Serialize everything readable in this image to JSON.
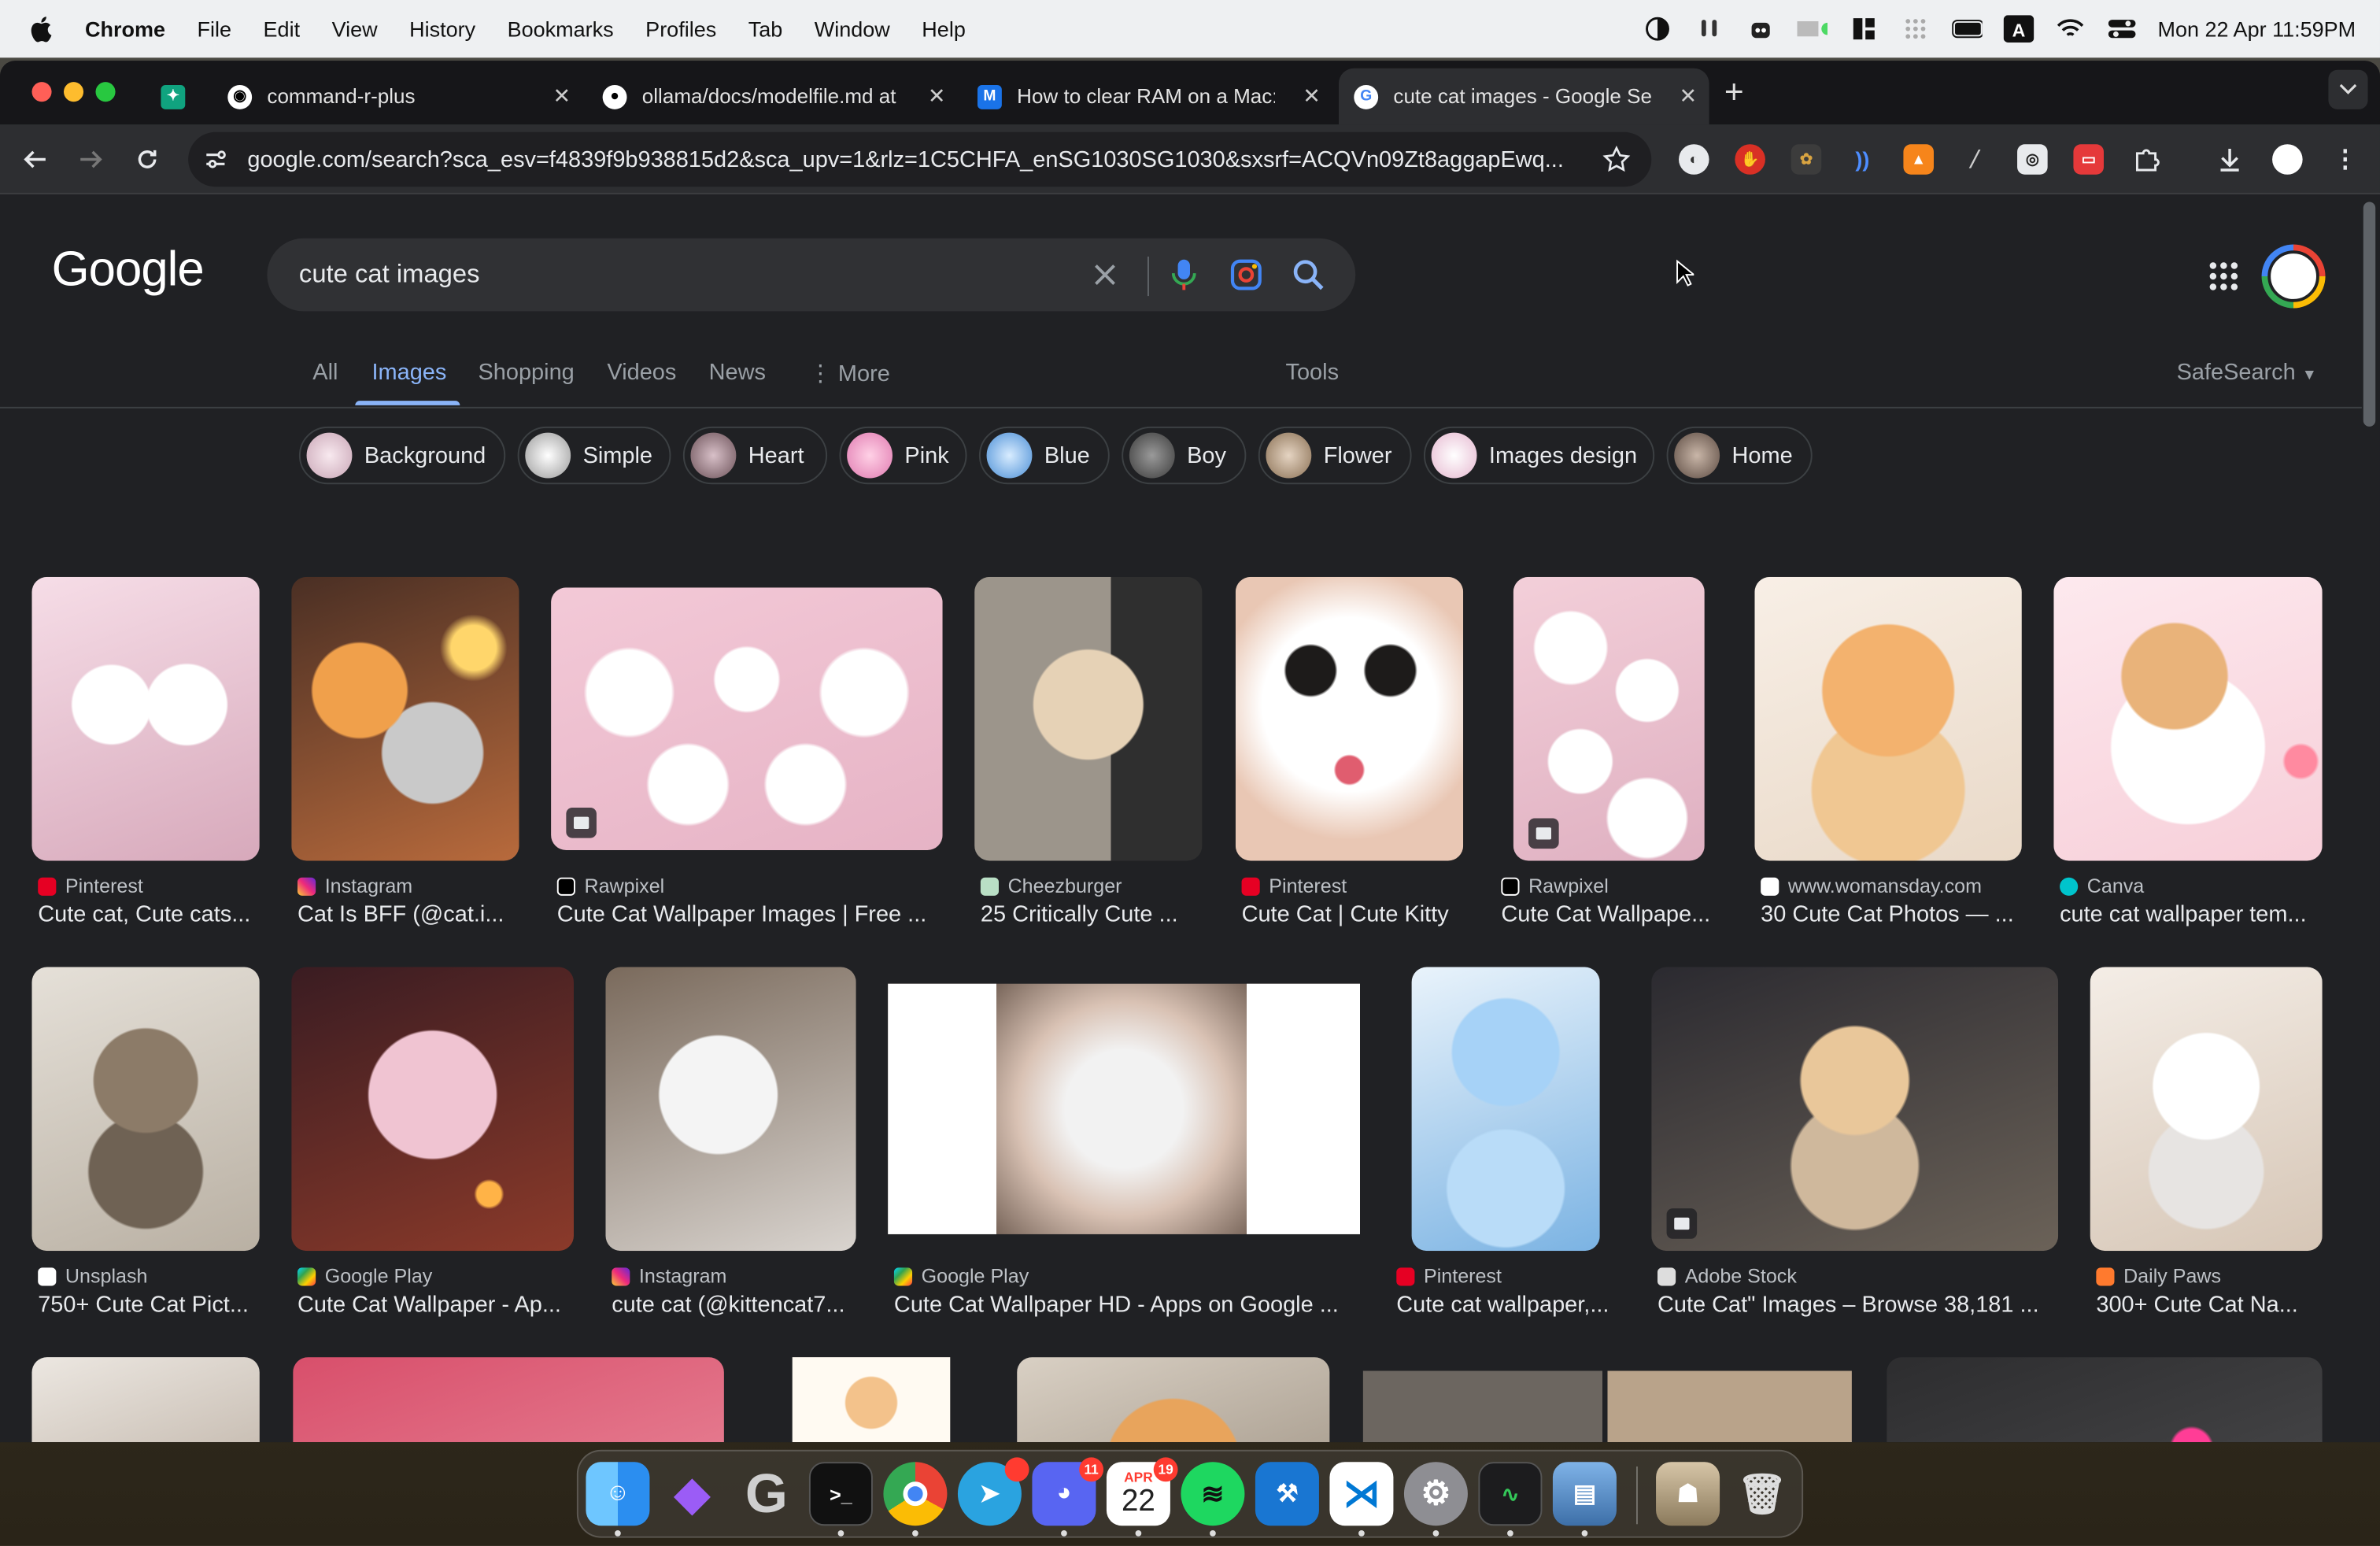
{
  "menubar": {
    "app_name": "Chrome",
    "items": [
      "File",
      "Edit",
      "View",
      "History",
      "Bookmarks",
      "Profiles",
      "Tab",
      "Window",
      "Help"
    ],
    "clock": "Mon 22 Apr  11:59PM"
  },
  "browser": {
    "tabs": [
      {
        "title": ""
      },
      {
        "title": "command-r-plus"
      },
      {
        "title": "ollama/docs/modelfile.md at"
      },
      {
        "title": "How to clear RAM on a Mac: "
      },
      {
        "title": "cute cat images - Google Sea"
      }
    ],
    "address": "google.com/search?sca_esv=f4839f9b938815d2&sca_upv=1&rlz=1C5CHFA_enSG1030SG1030&sxsrf=ACQVn09Zt8aggapEwq..."
  },
  "google": {
    "logo": "Google",
    "query": "cute cat images",
    "tabs": [
      "All",
      "Images",
      "Shopping",
      "Videos",
      "News",
      "More"
    ],
    "active_tab": "Images",
    "tools": "Tools",
    "safesearch": "SafeSearch",
    "chips": [
      "Background",
      "Simple",
      "Heart",
      "Pink",
      "Blue",
      "Boy",
      "Flower",
      "Images design",
      "Home"
    ],
    "results_row1": [
      {
        "source": "Pinterest",
        "caption": "Cute cat, Cute cats..."
      },
      {
        "source": "Instagram",
        "caption": "Cat Is BFF (@cat.i..."
      },
      {
        "source": "Rawpixel",
        "caption": "Cute Cat Wallpaper Images | Free ..."
      },
      {
        "source": "Cheezburger",
        "caption": "25 Critically Cute ..."
      },
      {
        "source": "Pinterest",
        "caption": "Cute Cat | Cute Kitty"
      },
      {
        "source": "Rawpixel",
        "caption": "Cute Cat Wallpape..."
      },
      {
        "source": "www.womansday.com",
        "caption": "30 Cute Cat Photos — ..."
      },
      {
        "source": "Canva",
        "caption": "cute cat wallpaper tem..."
      }
    ],
    "results_row2": [
      {
        "source": "Unsplash",
        "caption": "750+ Cute Cat Pict..."
      },
      {
        "source": "Google Play",
        "caption": "Cute Cat Wallpaper - Ap..."
      },
      {
        "source": "Instagram",
        "caption": "cute cat (@kittencat7..."
      },
      {
        "source": "Google Play",
        "caption": "Cute Cat Wallpaper HD - Apps on Google ..."
      },
      {
        "source": "Pinterest",
        "caption": "Cute cat wallpaper,..."
      },
      {
        "source": "Adobe Stock",
        "caption": "Cute Cat\" Images – Browse 38,181 ..."
      },
      {
        "source": "Daily Paws",
        "caption": "300+ Cute Cat Na..."
      }
    ]
  },
  "dock": {
    "discord_badge": "11",
    "calendar_month": "APR",
    "calendar_day": "22",
    "calendar_badge": "19"
  }
}
